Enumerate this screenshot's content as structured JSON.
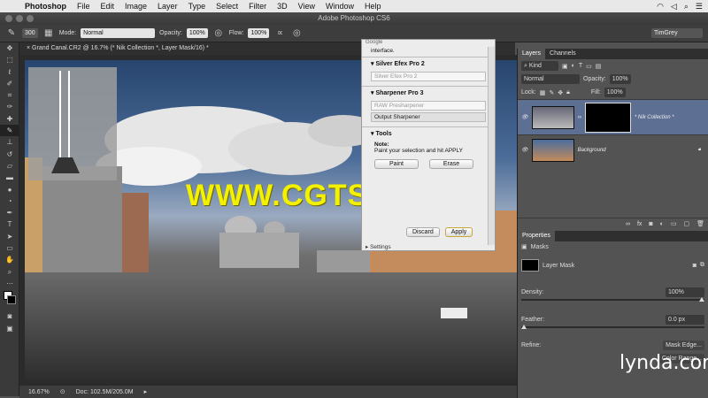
{
  "menubar": {
    "app": "Photoshop",
    "items": [
      "File",
      "Edit",
      "Image",
      "Layer",
      "Type",
      "Select",
      "Filter",
      "3D",
      "View",
      "Window",
      "Help"
    ]
  },
  "window": {
    "title": "Adobe Photoshop CS6"
  },
  "options": {
    "brush_size": "300",
    "mode_label": "Mode:",
    "mode_value": "Normal",
    "opacity_label": "Opacity:",
    "opacity_value": "100%",
    "flow_label": "Flow:",
    "flow_value": "100%",
    "workspace": "TimGrey"
  },
  "document": {
    "tab": "Grand Canal.CR2 @ 16.7% (* Nik Collection *, Layer Mask/16) *",
    "zoom": "16.67%",
    "doc_info": "Doc: 102.5M/205.0M"
  },
  "nik": {
    "header": "Google",
    "intro_text": "interface.",
    "sections": [
      {
        "title": "Silver Efex Pro 2",
        "items": [
          "Silver Efex Pro 2"
        ]
      },
      {
        "title": "Sharpener Pro 3",
        "items": [
          "RAW Presharpener",
          "Output Sharpener"
        ]
      }
    ],
    "tools_title": "Tools",
    "note_title": "Note:",
    "note_text": "Paint your selection and hit APPLY",
    "paint_label": "Paint",
    "erase_label": "Erase",
    "discard_label": "Discard",
    "apply_label": "Apply",
    "settings_label": "Settings"
  },
  "layers": {
    "tabs": [
      "Layers",
      "Channels"
    ],
    "kind_label": "Kind",
    "blend": "Normal",
    "opacity_label": "Opacity:",
    "opacity_value": "100%",
    "lock_label": "Lock:",
    "fill_label": "Fill:",
    "fill_value": "100%",
    "items": [
      {
        "name": "* Nik Collection *",
        "selected": true
      },
      {
        "name": "Background",
        "selected": false
      }
    ]
  },
  "properties": {
    "tab": "Properties",
    "masks_label": "Masks",
    "mask_name": "Layer Mask",
    "density_label": "Density:",
    "density_value": "100%",
    "feather_label": "Feather:",
    "feather_value": "0.0 px",
    "refine_label": "Refine:",
    "mask_edge_label": "Mask Edge...",
    "color_range_label": "Color Range..."
  },
  "overlay": {
    "watermark": "WWW.CGTSJ.COM",
    "brand": "lynda.com"
  },
  "colors": {
    "accent": "#5d6f93",
    "watermark": "#f3f000",
    "canvas_bg": "#2b2b2b"
  }
}
